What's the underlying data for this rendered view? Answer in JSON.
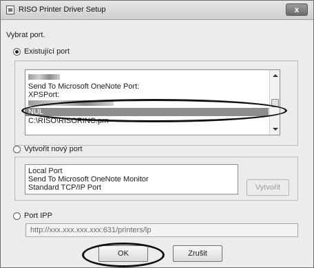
{
  "window": {
    "title": "RISO Printer Driver Setup",
    "close_label": "x"
  },
  "dialog": {
    "heading": "Vybrat port.",
    "existing_port": {
      "label": "Existující port",
      "selected": true,
      "items": [
        {
          "text": "",
          "redacted": true
        },
        {
          "text": "Send To Microsoft OneNote Port:",
          "redacted": false
        },
        {
          "text": "XPSPort:",
          "redacted": false
        },
        {
          "text": "",
          "redacted": true
        },
        {
          "text": "NUL",
          "redacted": false,
          "selected": true
        },
        {
          "text": "C:\\RISO\\RISORINC.prn",
          "redacted": false
        }
      ]
    },
    "new_port": {
      "label": "Vytvořit nový port",
      "selected": false,
      "items": [
        "Local Port",
        "Send To Microsoft OneNote Monitor",
        "Standard TCP/IP Port"
      ],
      "create_label": "Vytvořit"
    },
    "ipp": {
      "label": "Port IPP",
      "selected": false,
      "url": "http://xxx.xxx.xxx.xxx:631/printers/lp"
    },
    "ok_label": "OK",
    "cancel_label": "Zrušit"
  }
}
